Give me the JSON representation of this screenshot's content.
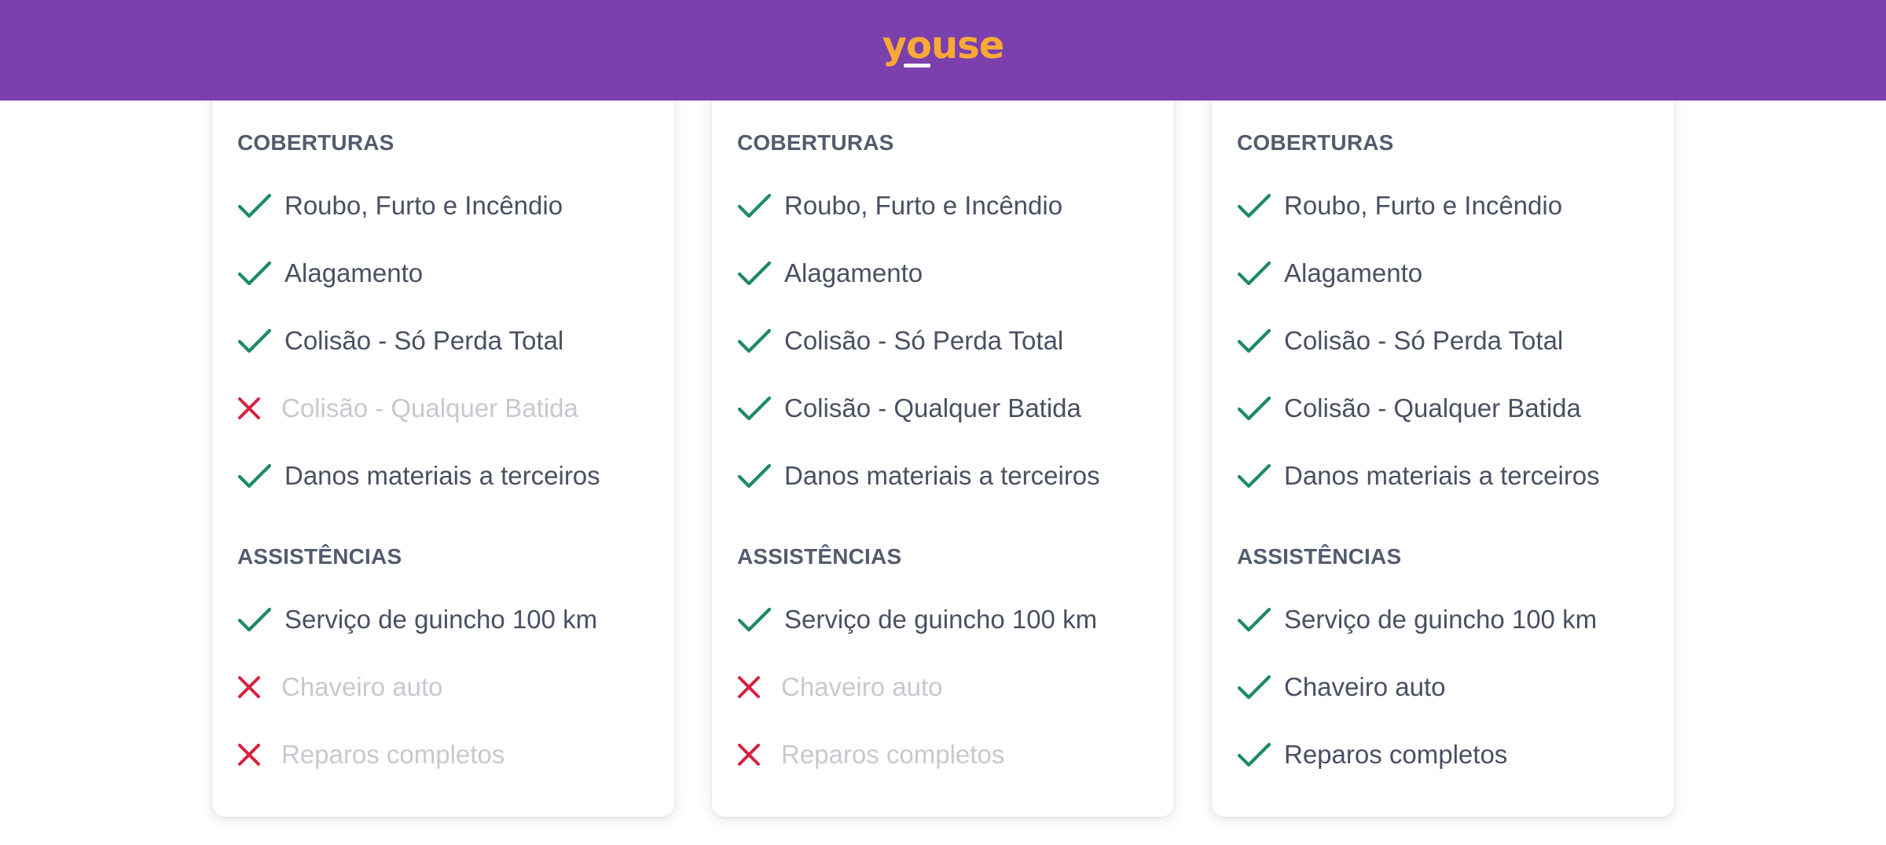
{
  "header": {
    "brand": "youse",
    "background": "#7b40ae",
    "logo_color": "#f9a936"
  },
  "colors": {
    "check": "#1e8a64",
    "cross": "#d6213f",
    "text": "#4a5062",
    "text_disabled": "#c7c9cf",
    "heading": "#545b6e"
  },
  "plans": [
    {
      "coverage_title": "COBERTURAS",
      "coverage": [
        {
          "label": "Roubo, Furto e Incêndio",
          "included": true,
          "icon": "check-icon"
        },
        {
          "label": "Alagamento",
          "included": true,
          "icon": "check-icon"
        },
        {
          "label": "Colisão - Só Perda Total",
          "included": true,
          "icon": "check-icon"
        },
        {
          "label": "Colisão - Qualquer Batida",
          "included": false,
          "icon": "close-icon"
        },
        {
          "label": "Danos materiais a terceiros",
          "included": true,
          "icon": "check-icon"
        }
      ],
      "assist_title": "ASSISTÊNCIAS",
      "assistance": [
        {
          "label": "Serviço de guincho 100 km",
          "included": true,
          "icon": "check-icon"
        },
        {
          "label": "Chaveiro auto",
          "included": false,
          "icon": "close-icon"
        },
        {
          "label": "Reparos completos",
          "included": false,
          "icon": "close-icon"
        }
      ]
    },
    {
      "coverage_title": "COBERTURAS",
      "coverage": [
        {
          "label": "Roubo, Furto e Incêndio",
          "included": true,
          "icon": "check-icon"
        },
        {
          "label": "Alagamento",
          "included": true,
          "icon": "check-icon"
        },
        {
          "label": "Colisão - Só Perda Total",
          "included": true,
          "icon": "check-icon"
        },
        {
          "label": "Colisão - Qualquer Batida",
          "included": true,
          "icon": "check-icon"
        },
        {
          "label": "Danos materiais a terceiros",
          "included": true,
          "icon": "check-icon"
        }
      ],
      "assist_title": "ASSISTÊNCIAS",
      "assistance": [
        {
          "label": "Serviço de guincho 100 km",
          "included": true,
          "icon": "check-icon"
        },
        {
          "label": "Chaveiro auto",
          "included": false,
          "icon": "close-icon"
        },
        {
          "label": "Reparos completos",
          "included": false,
          "icon": "close-icon"
        }
      ]
    },
    {
      "coverage_title": "COBERTURAS",
      "coverage": [
        {
          "label": "Roubo, Furto e Incêndio",
          "included": true,
          "icon": "check-icon"
        },
        {
          "label": "Alagamento",
          "included": true,
          "icon": "check-icon"
        },
        {
          "label": "Colisão - Só Perda Total",
          "included": true,
          "icon": "check-icon"
        },
        {
          "label": "Colisão - Qualquer Batida",
          "included": true,
          "icon": "check-icon"
        },
        {
          "label": "Danos materiais a terceiros",
          "included": true,
          "icon": "check-icon"
        }
      ],
      "assist_title": "ASSISTÊNCIAS",
      "assistance": [
        {
          "label": "Serviço de guincho 100 km",
          "included": true,
          "icon": "check-icon"
        },
        {
          "label": "Chaveiro auto",
          "included": true,
          "icon": "check-icon"
        },
        {
          "label": "Reparos completos",
          "included": true,
          "icon": "check-icon"
        }
      ]
    }
  ]
}
